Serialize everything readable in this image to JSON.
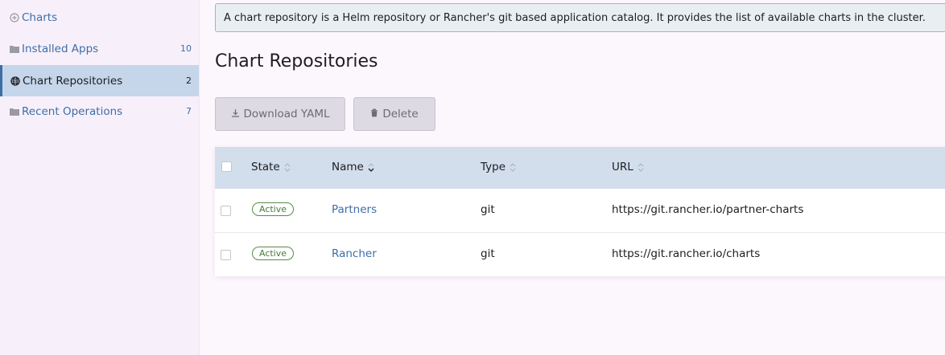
{
  "sidebar": {
    "items": [
      {
        "label": "Charts",
        "count": "",
        "icon": "plus-circle-icon"
      },
      {
        "label": "Installed Apps",
        "count": "10",
        "icon": "folder-icon"
      },
      {
        "label": "Chart Repositories",
        "count": "2",
        "icon": "globe-icon",
        "active": true
      },
      {
        "label": "Recent Operations",
        "count": "7",
        "icon": "folder-icon"
      }
    ]
  },
  "banner": {
    "text": "A chart repository is a Helm repository or Rancher's git based application catalog. It provides the list of available charts in the cluster."
  },
  "page": {
    "title": "Chart Repositories"
  },
  "toolbar": {
    "download_label": "Download YAML",
    "delete_label": "Delete"
  },
  "table": {
    "headers": {
      "state": "State",
      "name": "Name",
      "type": "Type",
      "url": "URL"
    },
    "rows": [
      {
        "state": "Active",
        "name": "Partners",
        "type": "git",
        "url": "https://git.rancher.io/partner-charts"
      },
      {
        "state": "Active",
        "name": "Rancher",
        "type": "git",
        "url": "https://git.rancher.io/charts"
      }
    ]
  },
  "colors": {
    "accent": "#3d6ea8",
    "active_nav_bg": "#c5d6ea",
    "header_bg": "#d2deec",
    "active_badge": "#4a7a3a"
  }
}
